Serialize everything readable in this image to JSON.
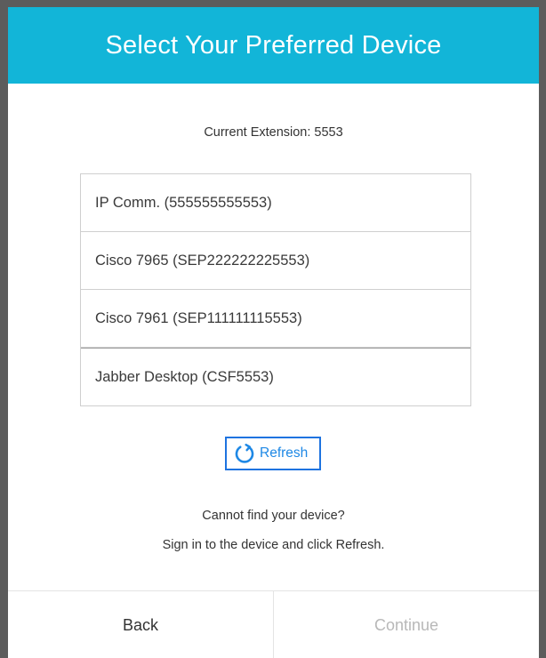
{
  "dialog": {
    "title": "Select Your Preferred Device",
    "current_extension": "Current Extension: 5553"
  },
  "devices": [
    {
      "label": "IP Comm. (555555555553)"
    },
    {
      "label": "Cisco 7965 (SEP222222225553)"
    },
    {
      "label": "Cisco 7961 (SEP111111115553)"
    },
    {
      "label": "Jabber Desktop (CSF5553)"
    }
  ],
  "refresh": {
    "label": "Refresh",
    "icon": "refresh-icon"
  },
  "help": {
    "line1": "Cannot find your device?",
    "line2": "Sign in to the device and click Refresh."
  },
  "footer": {
    "back_label": "Back",
    "continue_label": "Continue"
  },
  "colors": {
    "header_bg": "#12b5d8",
    "accent": "#1e73e0",
    "disabled_text": "#b8b8b8",
    "frame": "#5c5c5c"
  }
}
